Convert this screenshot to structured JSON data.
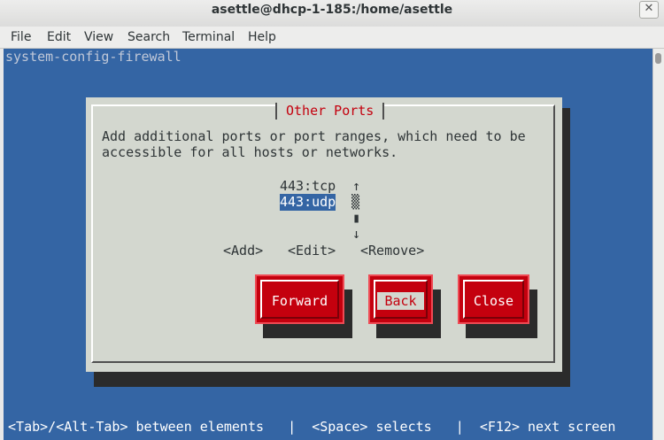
{
  "window": {
    "title": "asettle@dhcp-1-185:/home/asettle",
    "close_glyph": "✕"
  },
  "menubar": [
    "File",
    "Edit",
    "View",
    "Search",
    "Terminal",
    "Help"
  ],
  "terminal": {
    "app_name": "system-config-firewall",
    "dialog": {
      "title": "Other Ports",
      "description_line1": "Add additional ports or port ranges, which need to be",
      "description_line2": "accessible for all hosts or networks.",
      "ports": [
        "443:tcp",
        "443:udp"
      ],
      "scroll_up": "↑",
      "scroll_thumb": "▒",
      "scroll_block": "▮",
      "scroll_down": "↓",
      "actions": {
        "add": "<Add>",
        "edit": "<Edit>",
        "remove": "<Remove>"
      },
      "buttons": {
        "forward": "Forward",
        "back": "Back",
        "close": "Close"
      }
    },
    "hint_bar": " <Tab>/<Alt-Tab> between elements   |  <Space> selects   |  <F12> next screen"
  },
  "colors": {
    "terminal_bg": "#3465a4",
    "dialog_bg": "#d3d7cf",
    "accent_red": "#c4000e"
  }
}
